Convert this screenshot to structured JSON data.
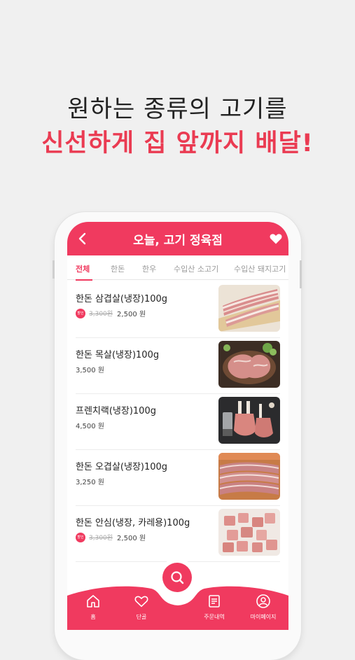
{
  "headline": {
    "line1": "원하는 종류의 고기를",
    "line2": "신선하게 집 앞까지 배달!"
  },
  "app": {
    "title": "오늘, 고기 정육점",
    "accent": "#f03a5f",
    "back_icon": "chevron-left-icon",
    "favorite_icon": "heart-icon"
  },
  "tabs": [
    {
      "label": "전체",
      "active": true
    },
    {
      "label": "한돈",
      "active": false
    },
    {
      "label": "한우",
      "active": false
    },
    {
      "label": "수입산 소고기",
      "active": false
    },
    {
      "label": "수입산 돼지고기",
      "active": false
    }
  ],
  "products": [
    {
      "name": "한돈 삼겹살(냉장)100g",
      "badge": "할인",
      "old_price": "3,300원",
      "price": "2,500 원",
      "image": "pork-belly"
    },
    {
      "name": "한돈 목살(냉장)100g",
      "badge": "",
      "old_price": "",
      "price": "3,500 원",
      "image": "pork-neck"
    },
    {
      "name": "프렌치랙(냉장)100g",
      "badge": "",
      "old_price": "",
      "price": "4,500 원",
      "image": "french-rack"
    },
    {
      "name": "한돈 오겹살(냉장)100g",
      "badge": "",
      "old_price": "",
      "price": "3,250 원",
      "image": "pork-five-layer"
    },
    {
      "name": "한돈 안심(냉장, 카레용)100g",
      "badge": "할인",
      "old_price": "3,300원",
      "price": "2,500 원",
      "image": "pork-tenderloin"
    }
  ],
  "bottom_nav": [
    {
      "label": "홈",
      "icon": "home-icon"
    },
    {
      "label": "단골",
      "icon": "heart-outline-icon"
    },
    {
      "label": "주문내역",
      "icon": "receipt-icon"
    },
    {
      "label": "마이페이지",
      "icon": "user-icon"
    }
  ],
  "fab_icon": "search-icon"
}
